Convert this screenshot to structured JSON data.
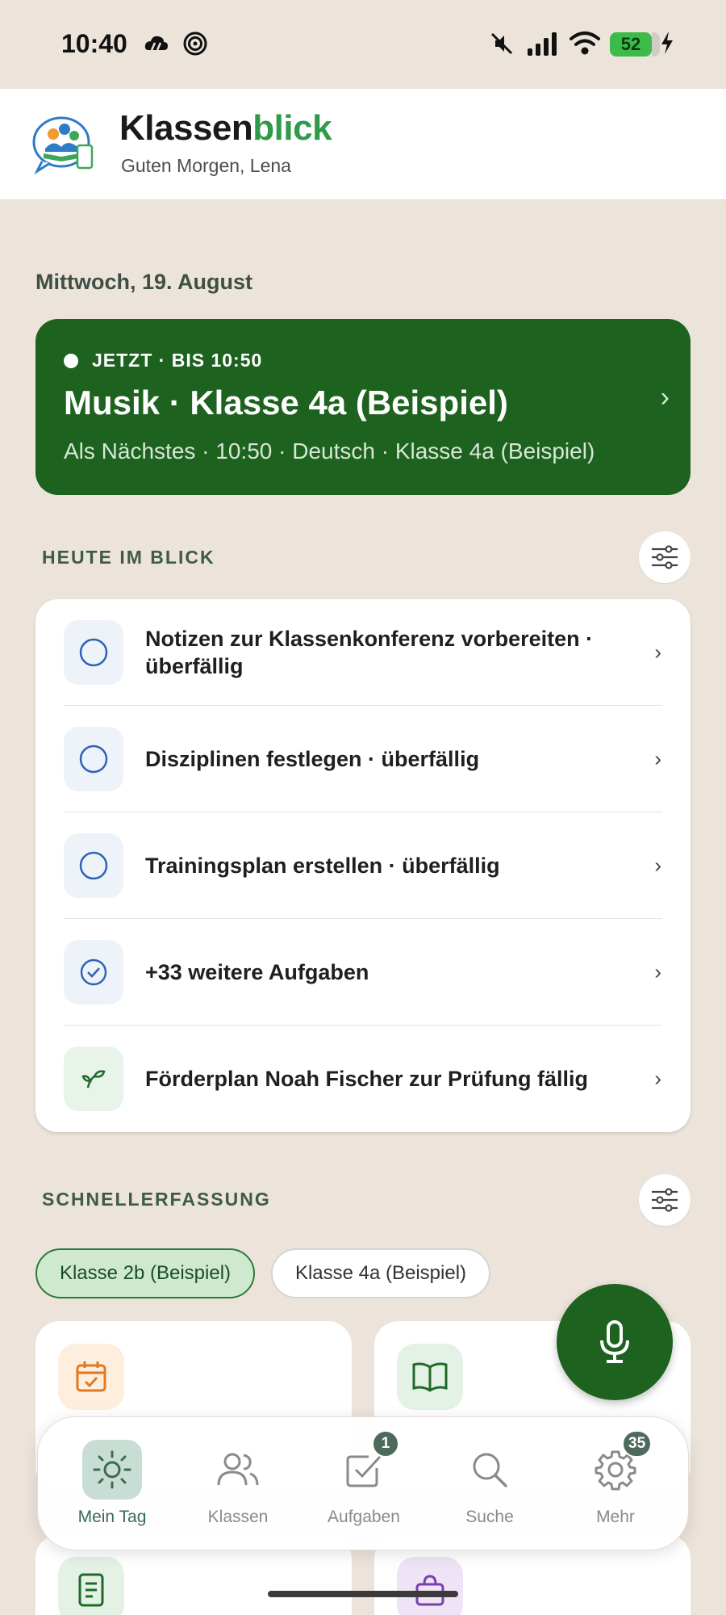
{
  "status": {
    "time": "10:40",
    "battery": "52"
  },
  "header": {
    "title_part1": "Klassen",
    "title_part2": "blick",
    "greeting": "Guten Morgen, Lena"
  },
  "date": "Mittwoch, 19. August",
  "now": {
    "label": "JETZT · BIS 10:50",
    "title": "Musik · Klasse 4a (Beispiel)",
    "next": "Als Nächstes · 10:50 · Deutsch · Klasse 4a (Beispiel)"
  },
  "today": {
    "title": "HEUTE IM BLICK",
    "tasks": [
      {
        "text": "Notizen zur Klassenkonferenz vorbereiten · überfällig",
        "icon": "circle-icon"
      },
      {
        "text": "Disziplinen festlegen · überfällig",
        "icon": "circle-icon"
      },
      {
        "text": "Trainingsplan erstellen · überfällig",
        "icon": "circle-icon"
      },
      {
        "text": "+33 weitere Aufgaben",
        "icon": "check-circle-icon"
      },
      {
        "text": "Förderplan Noah Fischer zur Prüfung fällig",
        "icon": "sprout-icon"
      }
    ]
  },
  "quick": {
    "title": "SCHNELLERFASSUNG",
    "chips": [
      "Klasse 2b (Beispiel)",
      "Klasse 4a (Beispiel)"
    ]
  },
  "nav": {
    "items": [
      {
        "label": "Mein Tag",
        "icon": "sun-icon"
      },
      {
        "label": "Klassen",
        "icon": "users-icon"
      },
      {
        "label": "Aufgaben",
        "icon": "checkbox-icon",
        "badge": "1"
      },
      {
        "label": "Suche",
        "icon": "search-icon"
      },
      {
        "label": "Mehr",
        "icon": "gear-icon",
        "badge": "35"
      }
    ]
  },
  "colors": {
    "primary": "#1e621f",
    "brand_green": "#2f9a4a",
    "background": "#ece4da"
  }
}
